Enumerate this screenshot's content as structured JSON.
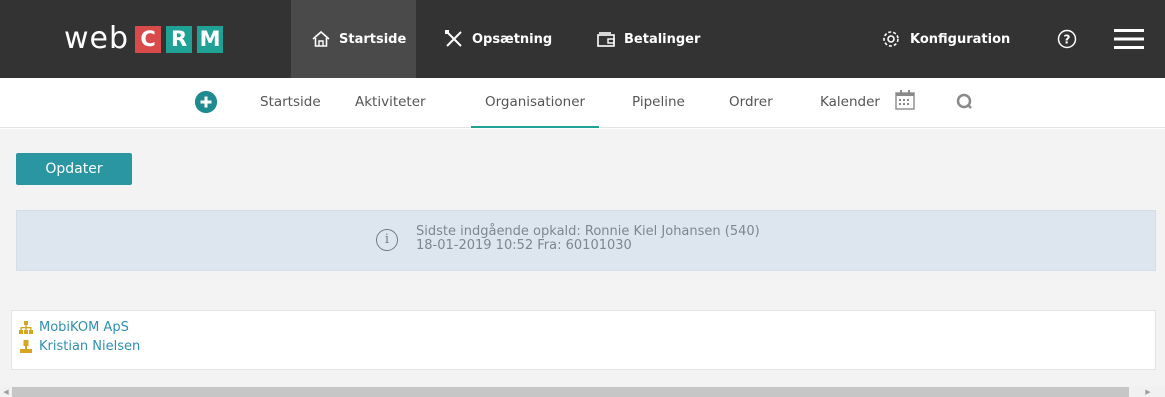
{
  "brand": {
    "web": "web",
    "c": "C",
    "r": "R",
    "m": "M"
  },
  "topnav": {
    "items": [
      {
        "label": "Startside",
        "icon": "home-icon",
        "active": true
      },
      {
        "label": "Opsætning",
        "icon": "tools-icon",
        "active": false
      },
      {
        "label": "Betalinger",
        "icon": "wallet-icon",
        "active": false
      }
    ],
    "config_label": "Konfiguration",
    "config_icon": "gear-icon",
    "help_icon": "help-icon",
    "menu_icon": "hamburger-menu-icon"
  },
  "subnav": {
    "add_icon": "plus-circle-icon",
    "items": [
      {
        "label": "Startside",
        "active": false
      },
      {
        "label": "Aktiviteter",
        "active": false
      },
      {
        "label": "Organisationer",
        "active": true
      },
      {
        "label": "Pipeline",
        "active": false
      },
      {
        "label": "Ordrer",
        "active": false
      },
      {
        "label": "Kalender",
        "icon": "calendar-icon",
        "active": false
      }
    ],
    "search_icon": "search-icon"
  },
  "toolbar": {
    "update_label": "Opdater"
  },
  "info": {
    "icon": "info-icon",
    "line1": "Sidste indgående opkald: Ronnie Kiel Johansen (540)",
    "line2": "18-01-2019 10:52 Fra: 60101030"
  },
  "results": [
    {
      "label": "MobiKOM ApS",
      "icon": "organization-icon"
    },
    {
      "label": "Kristian Nielsen",
      "icon": "person-icon"
    }
  ],
  "colors": {
    "topbar": "#333333",
    "accent_teal": "#1fa195",
    "brand_red": "#d94a4a",
    "button": "#2a96a1",
    "info_bg": "#dde6ee",
    "link": "#2f8fb3",
    "result_icon": "#d8a520"
  }
}
